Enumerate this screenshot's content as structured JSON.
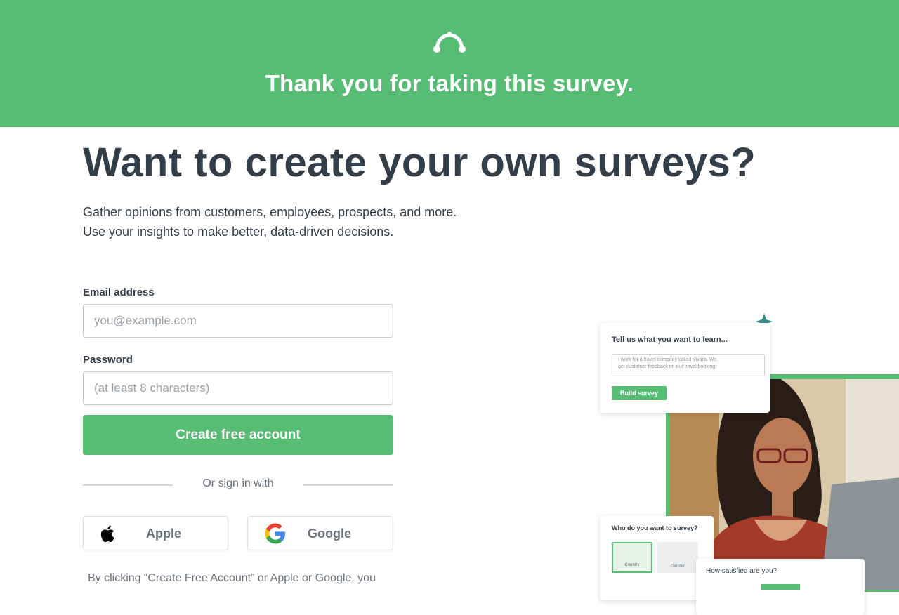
{
  "banner": {
    "title": "Thank you for taking this survey.",
    "logo_icon": "surveymonkey-logo-icon"
  },
  "hero": {
    "headline": "Want to create your own surveys?",
    "subtext_line1": "Gather opinions from customers, employees, prospects, and more.",
    "subtext_line2": "Use your insights to make better, data-driven decisions."
  },
  "form": {
    "email_label": "Email address",
    "email_placeholder": "you@example.com",
    "email_value": "",
    "password_label": "Password",
    "password_placeholder": "(at least 8 characters)",
    "password_value": "",
    "create_label": "Create free account",
    "divider_text": "Or sign in with",
    "apple_label": "Apple",
    "apple_icon": "apple-icon",
    "google_label": "Google",
    "google_icon": "google-icon",
    "legal_text": "By clicking “Create Free Account” or Apple or Google, you"
  },
  "illustration": {
    "card1_title": "Tell us what you want to learn...",
    "card1_input_line1": "I work for a travel company called Vivara. We",
    "card1_input_line2": "get customer feedback on our travel booking",
    "card1_button": "Build survey",
    "card2_title": "Who do you want to survey?",
    "card2_options": [
      "Country",
      "Gender"
    ],
    "card3_title": "How satisfied are you?",
    "sparkle_icon": "sparkle-icon"
  },
  "colors": {
    "brand_green": "#58bd74",
    "text_dark": "#333e48",
    "text_muted": "#6b747c"
  }
}
